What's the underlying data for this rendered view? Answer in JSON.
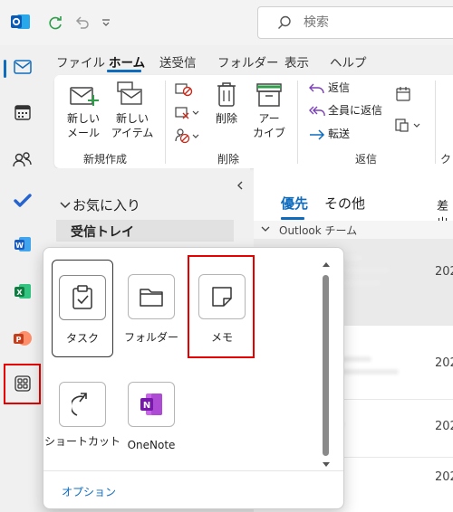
{
  "search": {
    "placeholder": "検索"
  },
  "tabs": [
    "ファイル",
    "ホーム",
    "送受信",
    "フォルダー",
    "表示",
    "ヘルプ"
  ],
  "ribbon": {
    "new_mail": "新しい\nメール",
    "new_item": "新しい\nアイテム",
    "new_group": "新規作成",
    "delete": "削除",
    "archive": "アー\nカイブ",
    "delete_group": "削除",
    "reply": "返信",
    "reply_all": "全員に返信",
    "forward": "転送",
    "respond_group": "返信",
    "cut_group": "クイ"
  },
  "folders": {
    "favorites": "お気に入り",
    "inbox": "受信トレイ"
  },
  "message_list": {
    "tab_focused": "優先",
    "tab_other": "その他",
    "col_from": "差出",
    "group_header": "Outlook チーム",
    "dates": [
      "202",
      "202",
      "202",
      "202"
    ]
  },
  "more_apps": {
    "tiles": [
      "タスク",
      "フォルダー",
      "メモ",
      "ショートカット",
      "OneNote"
    ],
    "options": "オプション"
  },
  "colors": {
    "accent": "#0f6cbd",
    "highlight": "#e60000"
  }
}
